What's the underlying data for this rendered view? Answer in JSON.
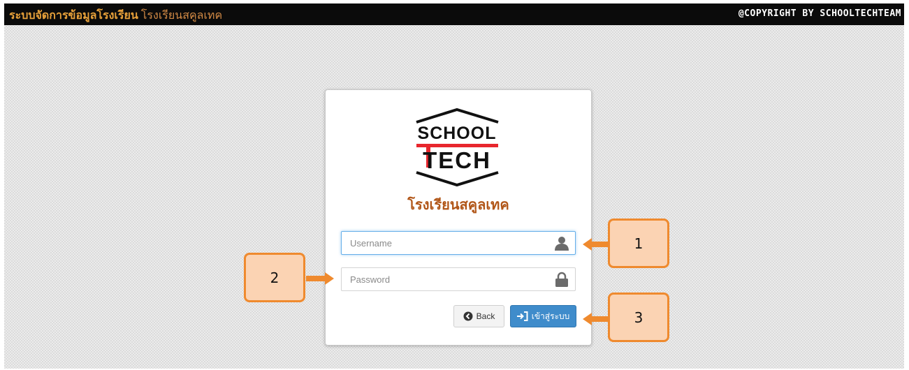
{
  "header": {
    "app_title": "ระบบจัดการข้อมูลโรงเรียน",
    "school_subtitle": "โรงเรียนสคูลเทค",
    "copyright": "@COPYRIGHT BY SCHOOLTECHTEAM"
  },
  "logo": {
    "line1": "SCHOOL",
    "line2": "TECH"
  },
  "login": {
    "school_name": "โรงเรียนสคูลเทค",
    "username_placeholder": "Username",
    "username_value": "",
    "password_placeholder": "Password",
    "password_value": "",
    "back_label": "Back",
    "login_label": "เข้าสู่ระบบ"
  },
  "callouts": {
    "one": "1",
    "two": "2",
    "three": "3"
  },
  "colors": {
    "accent_orange": "#ef8a2e",
    "callout_fill": "#fbd3b3",
    "login_button": "#3f8ccb",
    "logo_red": "#e8272d",
    "title_orange": "#b15618"
  },
  "icons": {
    "username_icon": "user-icon",
    "password_icon": "lock-icon",
    "back_icon": "arrow-circle-left-icon",
    "login_icon": "sign-in-icon"
  }
}
